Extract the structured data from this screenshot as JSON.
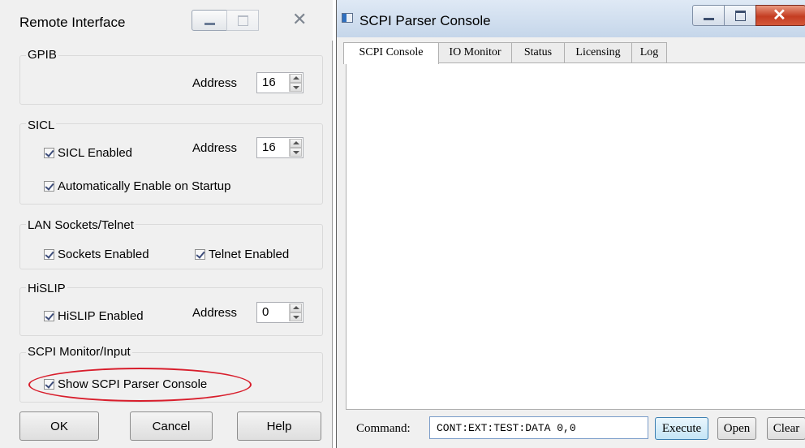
{
  "remote_window": {
    "title": "Remote Interface",
    "gpib": {
      "title": "GPIB",
      "address_label": "Address",
      "address_value": "16"
    },
    "sicl": {
      "title": "SICL",
      "enabled_label": "SICL Enabled",
      "enabled": true,
      "address_label": "Address",
      "address_value": "16",
      "auto_enable_label": "Automatically Enable on Startup",
      "auto_enable": true
    },
    "lan": {
      "title": "LAN Sockets/Telnet",
      "sockets_label": "Sockets Enabled",
      "sockets": true,
      "telnet_label": "Telnet Enabled",
      "telnet": true
    },
    "hislip": {
      "title": "HiSLIP",
      "enabled_label": "HiSLIP Enabled",
      "enabled": true,
      "address_label": "Address",
      "address_value": "0"
    },
    "scpi_monitor": {
      "title": "SCPI Monitor/Input",
      "show_console_label": "Show SCPI Parser Console",
      "show_console": true
    },
    "buttons": {
      "ok": "OK",
      "cancel": "Cancel",
      "help": "Help"
    },
    "highlight_color": "#d81e2c"
  },
  "console_window": {
    "title": "SCPI Parser Console",
    "tabs": [
      {
        "label": "SCPI Console",
        "active": true
      },
      {
        "label": "IO Monitor",
        "active": false
      },
      {
        "label": "Status",
        "active": false
      },
      {
        "label": "Licensing",
        "active": false
      },
      {
        "label": "Log",
        "active": false
      }
    ],
    "command_label": "Command:",
    "command_value": "CONT:EXT:TEST:DATA 0,0",
    "buttons": {
      "execute": "Execute",
      "open": "Open",
      "clear": "Clear"
    }
  }
}
